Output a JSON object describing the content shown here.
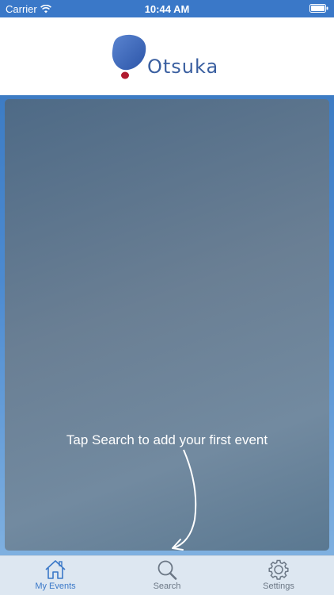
{
  "status_bar": {
    "carrier": "Carrier",
    "time": "10:44 AM"
  },
  "header": {
    "logo_text": "Otsuka"
  },
  "main": {
    "hint": "Tap Search to add your first event"
  },
  "tabs": [
    {
      "label": "My Events",
      "icon": "home-icon",
      "active": true
    },
    {
      "label": "Search",
      "icon": "search-icon",
      "active": false
    },
    {
      "label": "Settings",
      "icon": "gear-icon",
      "active": false
    }
  ],
  "colors": {
    "status_bar": "#3a78c8",
    "accent": "#3a78c8",
    "logo_blue": "#3a5fa0",
    "logo_red": "#b01a2e",
    "tab_inactive": "#6b7785"
  }
}
